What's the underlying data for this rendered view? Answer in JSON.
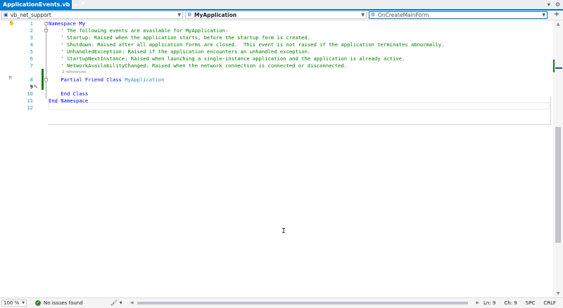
{
  "tab": {
    "title": "ApplicationEvents.vb",
    "pin_icon": "pin-icon",
    "close_icon": "close-icon"
  },
  "navbar": {
    "project": "vb_net_support",
    "type": "MyApplication",
    "member": "OnCreateMainForm"
  },
  "editor": {
    "lines": [
      {
        "n": "1",
        "tokens": [
          {
            "t": "Namespace My",
            "c": "kw"
          }
        ]
      },
      {
        "n": "2",
        "tokens": [
          {
            "t": "    ' The following events are available for MyApplication:",
            "c": "cm"
          }
        ]
      },
      {
        "n": "3",
        "tokens": [
          {
            "t": "    ' Startup: Raised when the application starts, before the startup form is created.",
            "c": "cm"
          }
        ]
      },
      {
        "n": "4",
        "tokens": [
          {
            "t": "    ' Shutdown: Raised after all application forms are closed.  This event is not raised if the application terminates abnormally.",
            "c": "cm"
          }
        ]
      },
      {
        "n": "5",
        "tokens": [
          {
            "t": "    ' UnhandledException: Raised if the application encounters an unhandled exception.",
            "c": "cm"
          }
        ]
      },
      {
        "n": "6",
        "tokens": [
          {
            "t": "    ' StartupNextInstance: Raised when launching a single-instance application and the application is already active.",
            "c": "cm"
          }
        ]
      },
      {
        "n": "7",
        "tokens": [
          {
            "t": "    ' NetworkAvailabilityChanged: Raised when the network connection is connected or disconnected.",
            "c": "cm"
          }
        ]
      },
      {
        "n": "8",
        "tokens": [
          {
            "t": "    Partial Friend Class ",
            "c": "kw"
          },
          {
            "t": "MyApplication",
            "c": "ty"
          }
        ]
      },
      {
        "n": "9",
        "tokens": [
          {
            "t": "",
            "c": ""
          }
        ]
      },
      {
        "n": "10",
        "tokens": [
          {
            "t": "    End Class",
            "c": "kw"
          }
        ]
      },
      {
        "n": "11",
        "tokens": [
          {
            "t": "End Namespace",
            "c": "kw"
          }
        ]
      },
      {
        "n": "12",
        "tokens": [
          {
            "t": "",
            "c": ""
          }
        ]
      }
    ],
    "codelens": "2 references",
    "current_line": "9"
  },
  "status": {
    "zoom": "100 %",
    "issues": "No issues found",
    "ln": "Ln: 9",
    "ch": "Ch: 9",
    "spc": "SPC",
    "eol": "CRLF"
  },
  "colors": {
    "accent": "#007acc",
    "keyword": "#0000ff",
    "comment": "#008000",
    "type": "#2b91af",
    "change": "#107c10"
  }
}
